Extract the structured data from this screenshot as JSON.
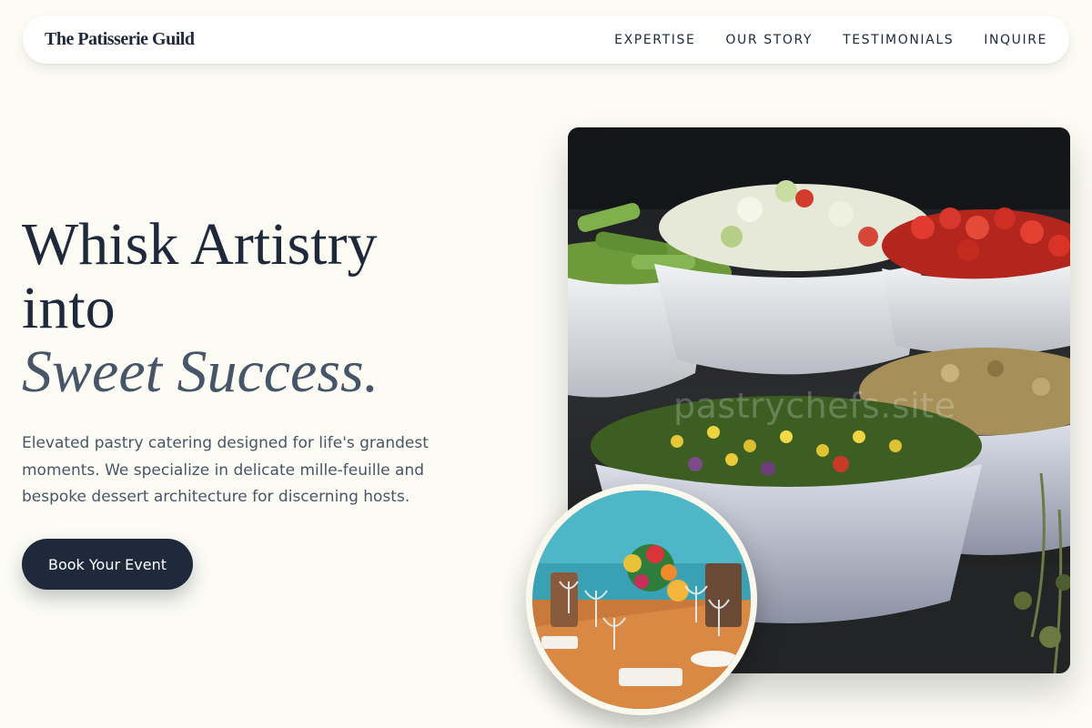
{
  "brand": "The Patisserie Guild",
  "nav": {
    "links": [
      "EXPERTISE",
      "OUR STORY",
      "TESTIMONIALS",
      "INQUIRE"
    ]
  },
  "hero": {
    "title_line1": "Whisk Artistry",
    "title_line2": "into",
    "title_emphasis": "Sweet Success.",
    "description": "Elevated pastry catering designed for life's grandest moments. We specialize in delicate mille-feuille and bespoke dessert architecture for discerning hosts.",
    "cta_label": "Book Your Event",
    "image_alt": "Catering bowls of salads on a buffet table",
    "watermark": "pastrychefs.site",
    "thumbnail_alt": "Banquet table with glasses and flower centerpieces"
  },
  "colors": {
    "background": "#fcfcf5",
    "primary": "#1e293b",
    "muted": "#475569"
  }
}
